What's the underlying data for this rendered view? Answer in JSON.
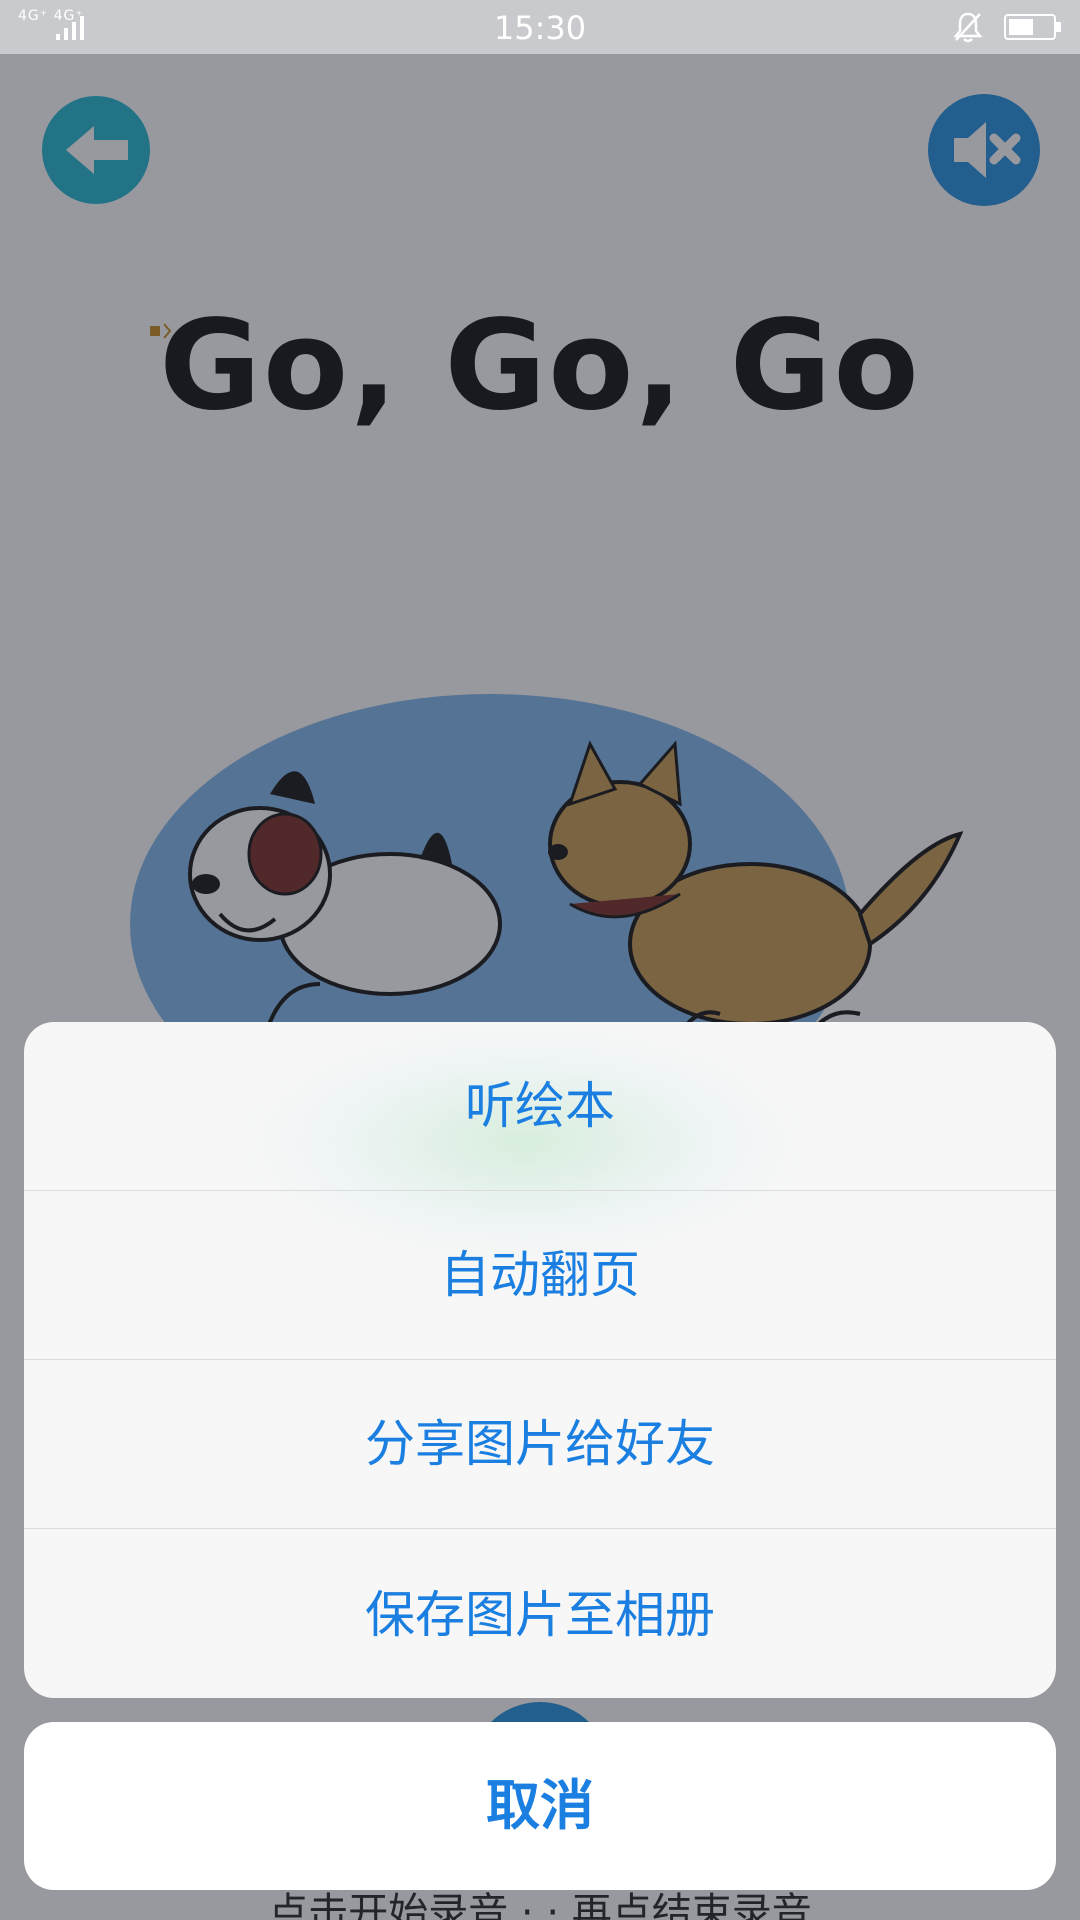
{
  "status_bar": {
    "network": "4G⁺ 4G⁺",
    "time": "15:30",
    "icons": [
      "signal-icon",
      "bell-muted-icon",
      "battery-icon"
    ]
  },
  "book": {
    "title": "Go, Go, Go"
  },
  "footer": {
    "record_hint": "点击开始录音 · · 再点结束录音"
  },
  "action_sheet": {
    "items": [
      {
        "label": "听绘本"
      },
      {
        "label": "自动翻页"
      },
      {
        "label": "分享图片给好友"
      },
      {
        "label": "保存图片至相册"
      }
    ],
    "cancel_label": "取消"
  },
  "colors": {
    "accent": "#1a7fe0",
    "back_button": "#1fb7d3",
    "mute_button": "#1e8fe0",
    "sheet_background": "#f7f7f7"
  }
}
